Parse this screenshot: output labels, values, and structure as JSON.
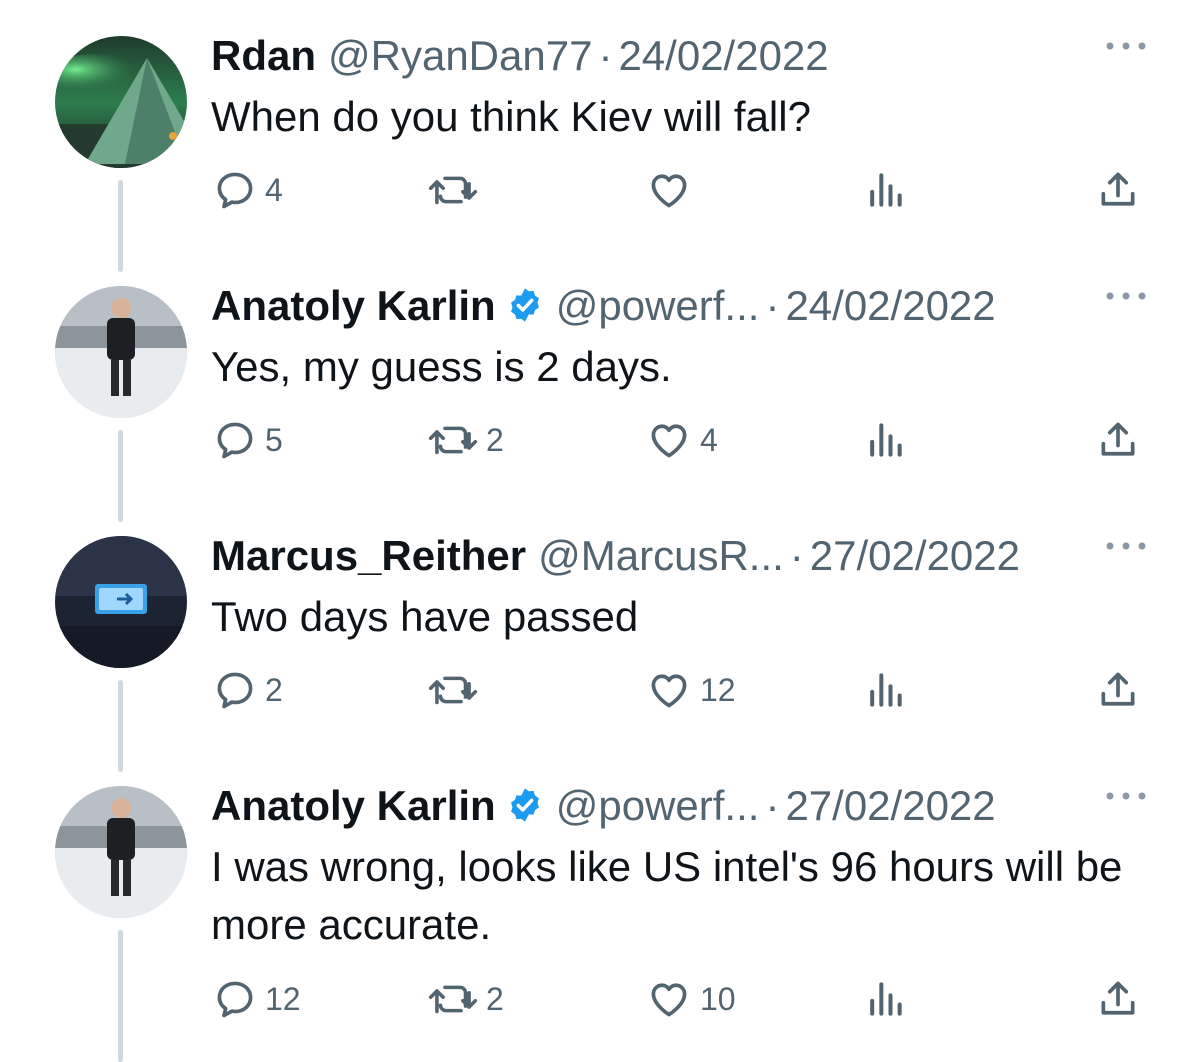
{
  "thread": [
    {
      "display_name": "Rdan",
      "verified": false,
      "handle": "@RyanDan77",
      "separator": "·",
      "date": "24/02/2022",
      "text": "When do you think Kiev will fall?",
      "avatar": "aurora-tent-photo",
      "replies": "4",
      "retweets": "",
      "likes": "",
      "views": ""
    },
    {
      "display_name": "Anatoly Karlin",
      "verified": true,
      "handle": "@powerf...",
      "separator": "·",
      "date": "24/02/2022",
      "text": "Yes, my guess is 2 days.",
      "avatar": "man-standing-in-snow-photo",
      "replies": "5",
      "retweets": "2",
      "likes": "4",
      "views": ""
    },
    {
      "display_name": "Marcus_Reither",
      "verified": false,
      "handle": "@MarcusR...",
      "separator": "·",
      "date": "27/02/2022",
      "text": "Two days have passed",
      "avatar": "exit-sign-photo",
      "replies": "2",
      "retweets": "",
      "likes": "12",
      "views": ""
    },
    {
      "display_name": "Anatoly Karlin",
      "verified": true,
      "handle": "@powerf...",
      "separator": "·",
      "date": "27/02/2022",
      "text": "I was wrong, looks like US intel's 96 hours will be more accurate.",
      "avatar": "man-standing-in-snow-photo",
      "replies": "12",
      "retweets": "2",
      "likes": "10",
      "views": ""
    }
  ],
  "icons": {
    "reply": "reply-icon",
    "retweet": "retweet-icon",
    "like": "heart-icon",
    "views": "views-icon",
    "share": "share-icon",
    "more": "more-icon",
    "verified": "verified-badge-icon"
  },
  "colors": {
    "text": "#0f1419",
    "secondary": "#536471",
    "verified": "#1d9bf0",
    "thread_line": "#cfd9de"
  }
}
